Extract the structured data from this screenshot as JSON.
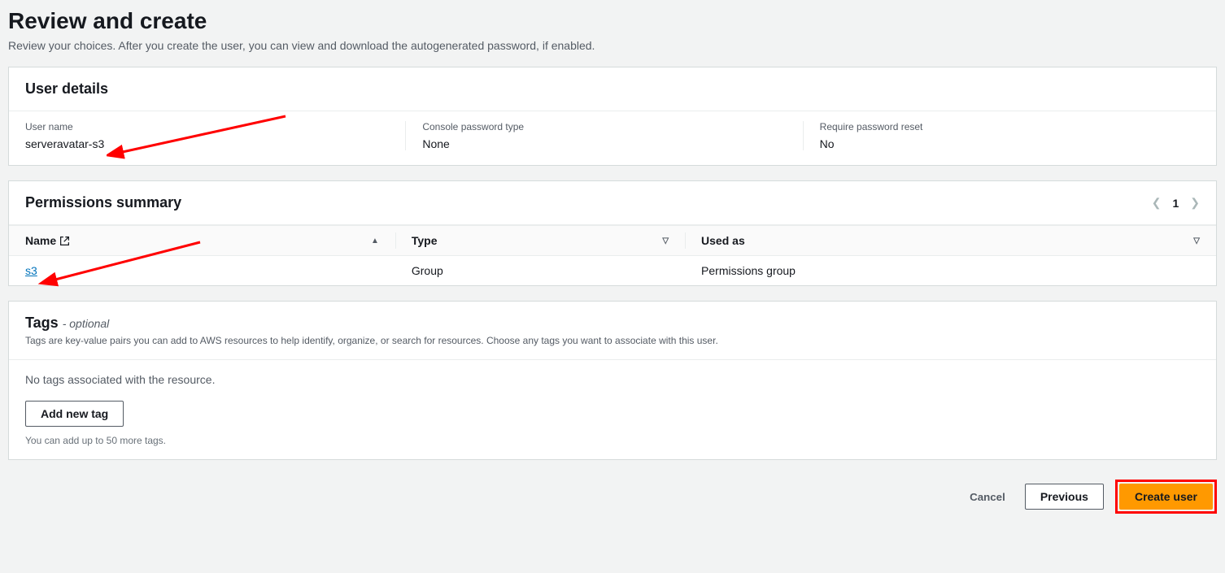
{
  "page": {
    "title": "Review and create",
    "subtitle": "Review your choices. After you create the user, you can view and download the autogenerated password, if enabled."
  },
  "user_details": {
    "title": "User details",
    "fields": {
      "username_label": "User name",
      "username_value": "serveravatar-s3",
      "pwtype_label": "Console password type",
      "pwtype_value": "None",
      "reset_label": "Require password reset",
      "reset_value": "No"
    }
  },
  "permissions": {
    "title": "Permissions summary",
    "pager": {
      "page": "1"
    },
    "columns": {
      "name": "Name",
      "type": "Type",
      "used_as": "Used as"
    },
    "rows": [
      {
        "name": "s3",
        "type": "Group",
        "used_as": "Permissions group"
      }
    ]
  },
  "tags": {
    "title": "Tags",
    "optional": "- optional",
    "desc": "Tags are key-value pairs you can add to AWS resources to help identify, organize, or search for resources. Choose any tags you want to associate with this user.",
    "empty": "No tags associated with the resource.",
    "add_button": "Add new tag",
    "hint": "You can add up to 50 more tags."
  },
  "footer": {
    "cancel": "Cancel",
    "previous": "Previous",
    "create": "Create user"
  }
}
